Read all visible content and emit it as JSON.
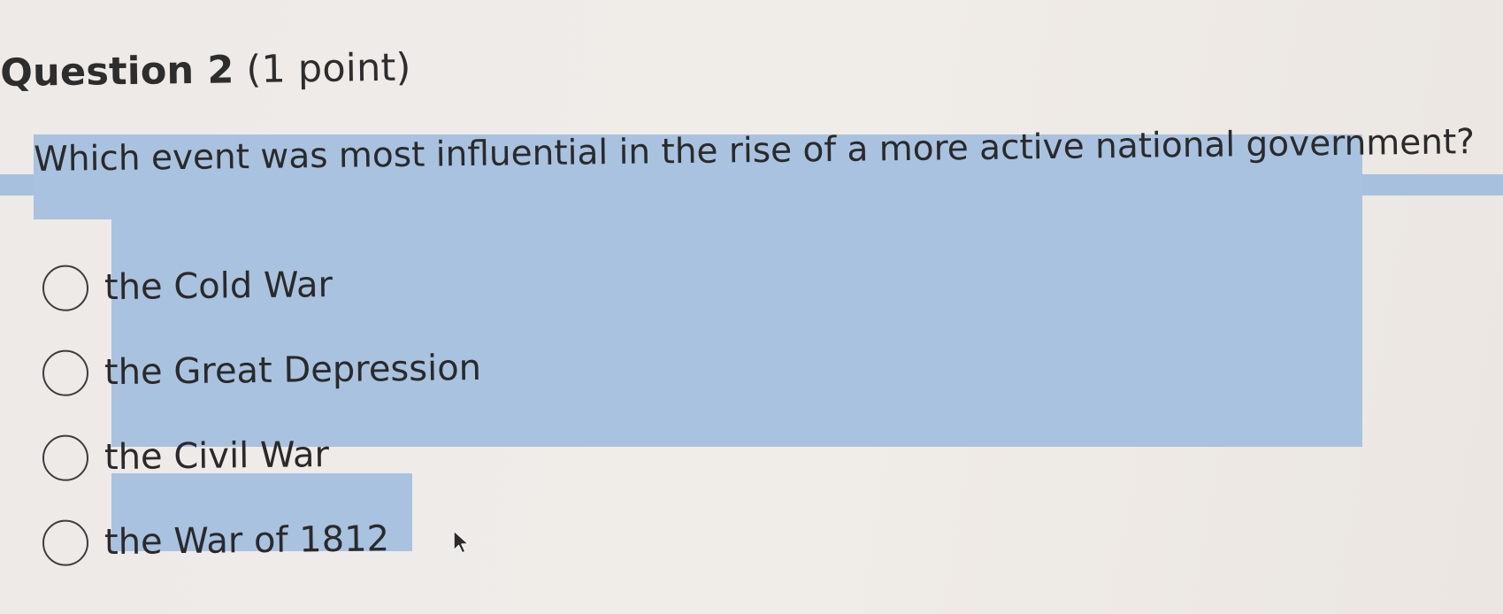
{
  "question": {
    "title": "Question 2",
    "points": "(1 point)",
    "prompt": "Which event was most influential in the rise of a more active national government?"
  },
  "options": [
    {
      "label": "the Cold War",
      "selected": false
    },
    {
      "label": "the Great Depression",
      "selected": false
    },
    {
      "label": "the Civil War",
      "selected": false
    },
    {
      "label": "the War of 1812",
      "selected": false
    }
  ],
  "colors": {
    "highlight": "#a9c2e0",
    "background": "#eeeae7",
    "text": "#2a2a2a"
  },
  "icons": {
    "cursor": "mouse-pointer-icon",
    "radio": "radio-unchecked-icon"
  }
}
